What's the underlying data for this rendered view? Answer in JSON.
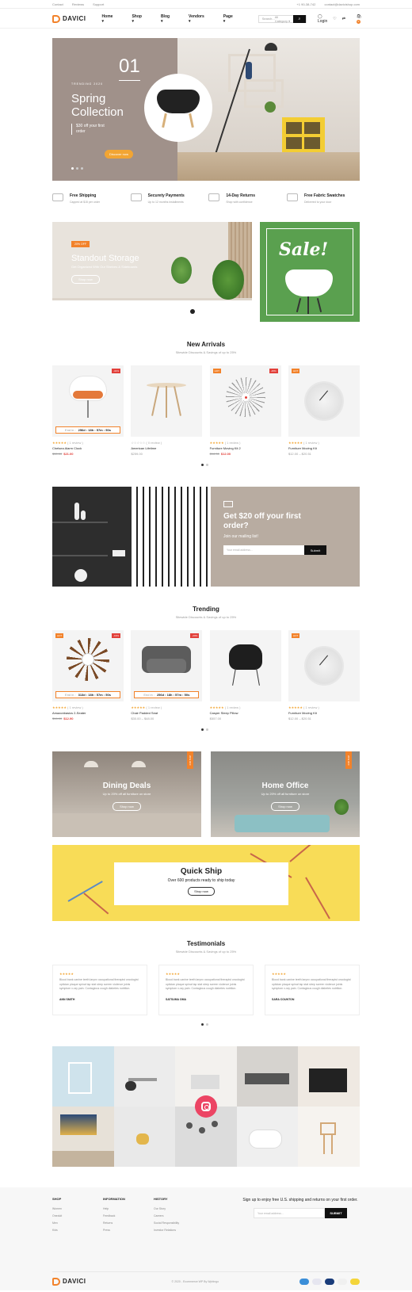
{
  "topbar": {
    "links": [
      "Contact",
      "Reviews",
      "Support"
    ],
    "phone": "+1 90-38-742",
    "email": "contact@davicishop.com"
  },
  "header": {
    "logo": "DAVICI",
    "nav": [
      "Home",
      "Shop",
      "Blog",
      "Vendors",
      "Page"
    ],
    "search_placeholder": "Search...",
    "search_category": "All Category",
    "login": "Login",
    "cart_count": "0"
  },
  "hero": {
    "slide_number": "01",
    "tag": "TRENDING 2020",
    "title": "Spring Collection",
    "subtitle": "$30 off your first order",
    "button": "Discover now"
  },
  "features": [
    {
      "title": "Free Shipping",
      "text": "Capped at $15 per order",
      "icon": "truck-icon"
    },
    {
      "title": "Securety Payments",
      "text": "Up to 12 months installments",
      "icon": "card-icon"
    },
    {
      "title": "14-Day Returns",
      "text": "Shop with confidence",
      "icon": "return-icon"
    },
    {
      "title": "Free Fabric Swatches",
      "text": "Delivered to your door",
      "icon": "swatch-icon"
    }
  ],
  "banner_storage": {
    "badge": "20% OFF",
    "title": "Standout Storage",
    "text": "Get Organized With Our Shelves & Sideboards",
    "button": "Shop now"
  },
  "banner_sale": {
    "word": "Sale!"
  },
  "new_arrivals": {
    "title": "New Arrivals",
    "subtitle": "Sitewide Discounts & Savings of up to 25%",
    "products": [
      {
        "name": "Chelsea Alarm Clock",
        "old": "$30.00",
        "price": "$21.00",
        "reviews": "( 1 review )",
        "tag_r": "-31%",
        "countdown": {
          "label": "End in :",
          "value": "256d : 18h : 57m : 50s"
        }
      },
      {
        "name": "American Lifetime",
        "price": "$259.00",
        "reviews": "( 0 review )"
      },
      {
        "name": "Furniture Moving Kit 2",
        "old": "$16.00",
        "price": "$12.00",
        "reviews": "( 1 review )",
        "tag_l": "HOT",
        "tag_r": "-25%"
      },
      {
        "name": "Furniture Moving Kit",
        "price": "$12.00 – $20.51",
        "reviews": "( 1 review )",
        "tag_l": "HOT"
      }
    ]
  },
  "newsletter": {
    "title": "Get $20 off your first order?",
    "text": "Join our mailing list!",
    "placeholder": "Your email address...",
    "button": "Submit"
  },
  "trending": {
    "title": "Trending",
    "subtitle": "Sitewide Discounts & Savings of up to 25%",
    "products": [
      {
        "name": "Amazonbasics 2-Seater",
        "old": "$16.00",
        "price": "$12.90",
        "reviews": "( 1 review )",
        "tag_l": "HOT",
        "tag_r": "-19%",
        "countdown": {
          "label": "End in :",
          "value": "313d : 18h : 57m : 50s"
        }
      },
      {
        "name": "Chair Padded Seat",
        "price": "$30.00 – $48.00",
        "reviews": "( 1 review )",
        "tag_r": "-20%",
        "countdown": {
          "label": "End in :",
          "value": "256d : 18h : 57m : 50s"
        }
      },
      {
        "name": "Casper Sleep Pillow",
        "price": "$557.00",
        "reviews": "( 1 review )"
      },
      {
        "name": "Furniture Moving Kit",
        "price": "$12.00 – $20.51",
        "reviews": "( 1 review )",
        "tag_l": "HOT"
      }
    ]
  },
  "deals": [
    {
      "title": "Dining Deals",
      "text": "Up to 20% off all furniture on store",
      "button": "Shop now",
      "ribbon": "20% OFF"
    },
    {
      "title": "Home Office",
      "text": "Up to 20% off all furniture on store",
      "button": "Shop now",
      "ribbon": "20% OFF"
    }
  ],
  "quick_ship": {
    "title": "Quick Ship",
    "text": "Over 600 products ready to ship today",
    "button": "Shop now"
  },
  "testimonials": {
    "title": "Testimonials",
    "subtitle": "Sitewide Discounts & Savings of up to 25%",
    "items": [
      {
        "text": "Blood bank canine teeth larynx occupational therapist oncologist optician plaque spinal tap stat strep screen violence joints symptom x-ray pain. Contagious cough diabetes nutrition.",
        "author": "ANN SMITH"
      },
      {
        "text": "Blood bank canine teeth larynx occupational therapist oncologist optician plaque spinal tap stat strep screen violence joints symptom x-ray pain. Contagious cough diabetes nutrition.",
        "author": "SATSUMA OMA"
      },
      {
        "text": "Blood bank canine teeth larynx occupational therapist oncologist optician plaque spinal tap stat strep screen violence joints symptom x-ray pain. Contagious cough diabetes nutrition.",
        "author": "SARA COUNTON"
      }
    ]
  },
  "footer": {
    "columns": [
      {
        "title": "SHOP",
        "items": [
          "Women",
          "Oneduit",
          "Men",
          "Kids"
        ]
      },
      {
        "title": "INFORMATION",
        "items": [
          "Help",
          "Feedback",
          "Returns",
          "Press"
        ]
      },
      {
        "title": "HISTORY",
        "items": [
          "Our Story",
          "Careers",
          "Social Responsibility",
          "Investor Relations"
        ]
      }
    ],
    "subscribe_text": "Sign up to enjoy free U.S. shipping and returns on your first order.",
    "subscribe_placeholder": "Your email address...",
    "subscribe_button": "SUBMIT",
    "logo": "DAVICI",
    "copyright": "© 2020 - Ecommerce WP By Wpbingo"
  },
  "colors": {
    "accent": "#f2822a",
    "sale_red": "#e2403a",
    "sale_green": "#5aa04f",
    "quick_yellow": "#f8dc57"
  }
}
